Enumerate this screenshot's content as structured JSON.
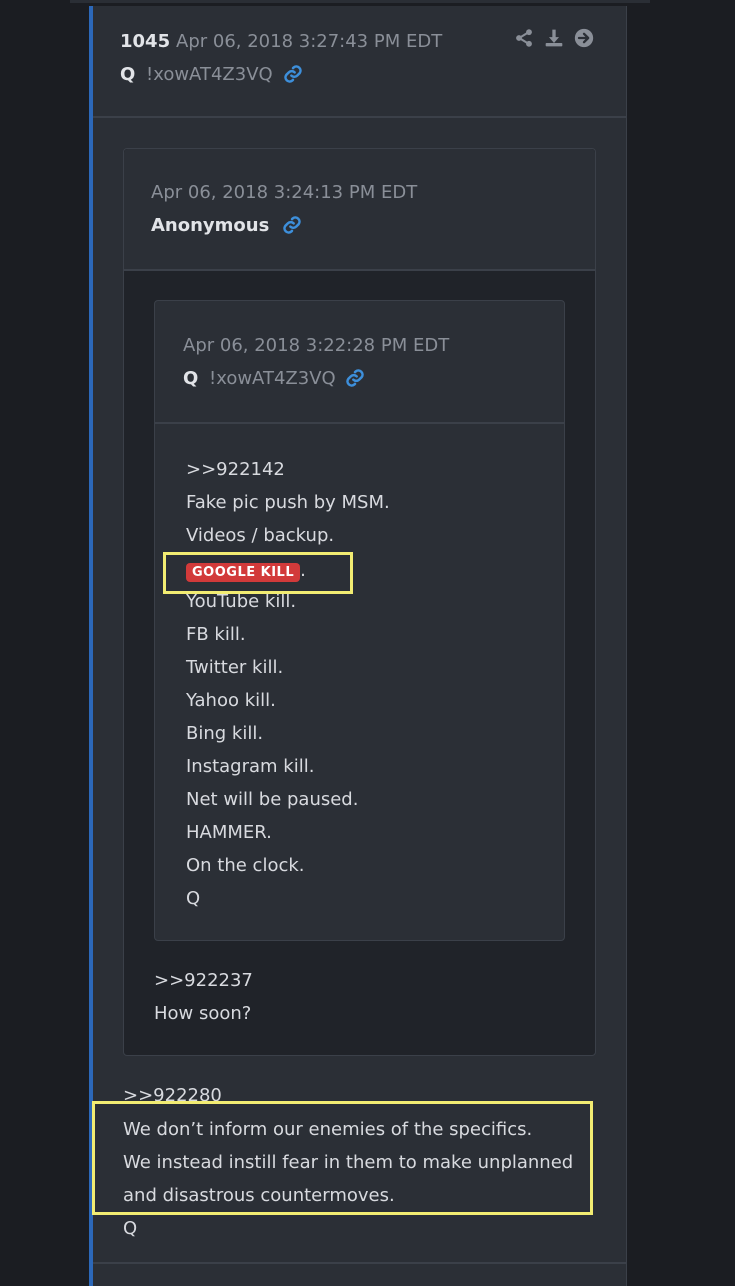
{
  "post": {
    "number": "1045",
    "date": "Apr 06, 2018 3:27:43 PM EDT",
    "author": "Q",
    "tripcode": "!xowAT4Z3VQ",
    "header_icons": [
      "share-icon",
      "download-icon",
      "arrow-right-circle-icon"
    ],
    "reply_ref": ">>922280",
    "body_lines": [
      "We don’t inform our enemies of the specifics.",
      "We instead instill fear in them to make unplanned",
      "and disastrous countermoves.",
      "Q"
    ]
  },
  "quote1": {
    "date": "Apr 06, 2018 3:24:13 PM EDT",
    "author": "Anonymous",
    "reply_ref": ">>922237",
    "body_lines": [
      "How soon?"
    ]
  },
  "quote2": {
    "date": "Apr 06, 2018 3:22:28 PM EDT",
    "author": "Q",
    "tripcode": "!xowAT4Z3VQ",
    "reply_ref": ">>922142",
    "lines_before": [
      "Fake pic push by MSM.",
      "Videos / backup."
    ],
    "badge_text": "GOOGLE KILL",
    "badge_suffix": ".",
    "lines_after": [
      "YouTube kill.",
      "FB kill.",
      "Twitter kill.",
      "Yahoo kill.",
      "Bing kill.",
      "Instagram kill.",
      "Net will be paused.",
      "HAMMER.",
      "On the clock.",
      "Q"
    ]
  },
  "colors": {
    "accent": "#2c68b9",
    "link": "#3d8fdb",
    "badge": "#d23a3a",
    "highlight": "#f2ec72"
  }
}
